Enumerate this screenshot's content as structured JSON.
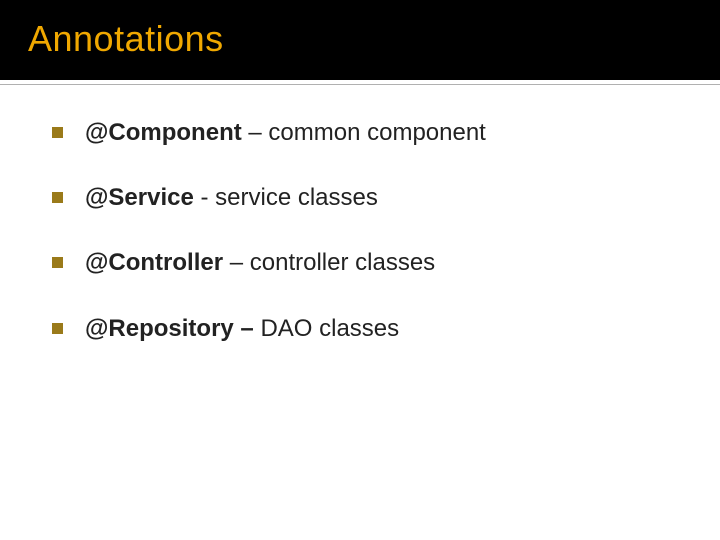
{
  "title": "Annotations",
  "items": [
    {
      "strong": "@Component",
      "sep": " – ",
      "rest": "common component"
    },
    {
      "strong": "@Service",
      "sep": "  - ",
      "rest": "service classes"
    },
    {
      "strong": "@Controller",
      "sep": " – ",
      "rest": "controller classes"
    },
    {
      "strong": "@Repository –",
      "sep": " ",
      "rest": "DAO classes"
    }
  ]
}
